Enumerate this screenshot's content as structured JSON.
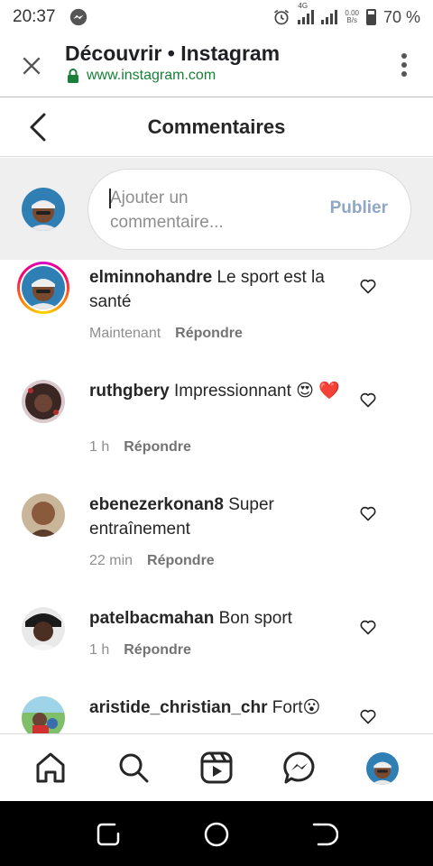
{
  "status": {
    "time": "20:37",
    "net_label": "4G",
    "speed_top": "0.00",
    "speed_bottom": "B/s",
    "battery": "70 %"
  },
  "browser": {
    "title": "Découvrir • Instagram",
    "url": "www.instagram.com"
  },
  "header": {
    "title": "Commentaires"
  },
  "composer": {
    "placeholder": "Ajouter un commentaire...",
    "publish_label": "Publier"
  },
  "comments": [
    {
      "username": "elminnohandre",
      "text": "Le sport est la santé",
      "time": "Maintenant",
      "reply_label": "Répondre"
    },
    {
      "username": "ruthgbery",
      "text": "Impressionnant 😍 ❤️",
      "time": "1 h",
      "reply_label": "Répondre"
    },
    {
      "username": "ebenezerkonan8",
      "text": "Super entraînement",
      "time": "22 min",
      "reply_label": "Répondre"
    },
    {
      "username": "patelbacmahan",
      "text": "Bon sport",
      "time": "1 h",
      "reply_label": "Répondre"
    },
    {
      "username": "aristide_christian_chr",
      "text": "Fort😮",
      "time": "",
      "reply_label": ""
    }
  ],
  "tabs": [
    "home-icon",
    "search-icon",
    "reels-icon",
    "messenger-icon",
    "profile-avatar"
  ],
  "colors": {
    "accent_disabled": "#8fa6c4",
    "secure_green": "#188038",
    "text_primary": "#262626",
    "text_secondary": "#8e8e8e"
  }
}
